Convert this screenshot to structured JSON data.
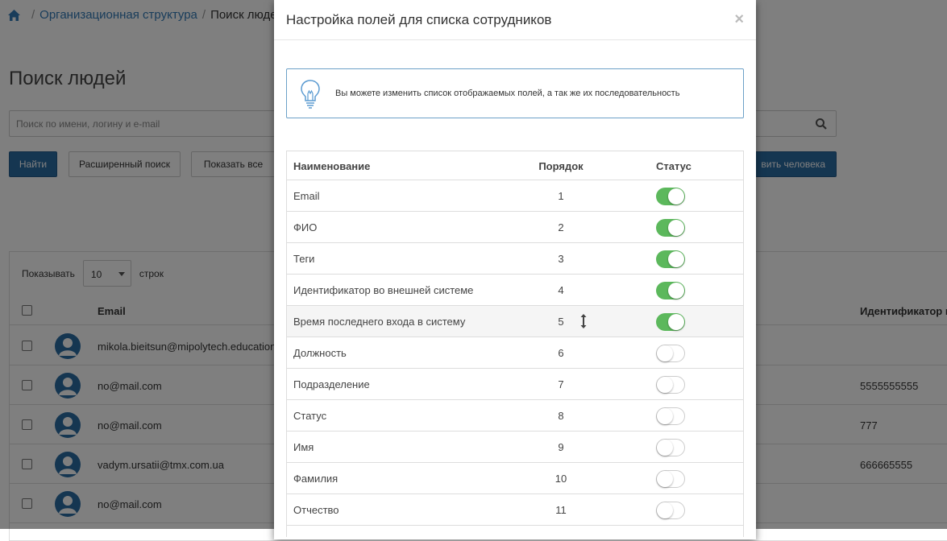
{
  "breadcrumb": {
    "home_icon": "home-icon",
    "org_link": "Организационная структура",
    "current": "Поиск людей"
  },
  "page": {
    "title": "Поиск людей",
    "search_placeholder": "Поиск по имени, логину и e-mail",
    "search_icon": "search-icon"
  },
  "toolbar": {
    "find": "Найти",
    "advanced": "Расширенный поиск",
    "show_all": "Показать все",
    "add_person": "вить человека"
  },
  "list": {
    "show_label": "Показывать",
    "rows_value": "10",
    "rows_label": "строк",
    "col_email": "Email",
    "col_ext_id": "Идентификатор в",
    "rows": [
      {
        "email": "mikola.bieitsun@mipolytech.education",
        "ext_id": ""
      },
      {
        "email": "no@mail.com",
        "ext_id": "5555555555"
      },
      {
        "email": "no@mail.com",
        "ext_id": "777"
      },
      {
        "email": "vadym.ursatii@tmx.com.ua",
        "ext_id": "666665555"
      },
      {
        "email": "no@mail.com",
        "ext_id": ""
      }
    ]
  },
  "modal": {
    "title": "Настройка полей для списка сотрудников",
    "close": "×",
    "info": "Вы можете изменить список отображаемых полей, а так же их последовательность",
    "col_name": "Наименование",
    "col_order": "Порядок",
    "col_status": "Статус",
    "fields": [
      {
        "name": "Email",
        "order": "1",
        "enabled": true
      },
      {
        "name": "ФИО",
        "order": "2",
        "enabled": true
      },
      {
        "name": "Теги",
        "order": "3",
        "enabled": true
      },
      {
        "name": "Идентификатор во внешней системе",
        "order": "4",
        "enabled": true
      },
      {
        "name": "Время последнего входа в систему",
        "order": "5",
        "enabled": true
      },
      {
        "name": "Должность",
        "order": "6",
        "enabled": false
      },
      {
        "name": "Подразделение",
        "order": "7",
        "enabled": false
      },
      {
        "name": "Статус",
        "order": "8",
        "enabled": false
      },
      {
        "name": "Имя",
        "order": "9",
        "enabled": false
      },
      {
        "name": "Фамилия",
        "order": "10",
        "enabled": false
      },
      {
        "name": "Отчество",
        "order": "11",
        "enabled": false
      }
    ]
  },
  "colors": {
    "primary": "#2b6ca3",
    "toggle_on": "#5cb85c",
    "link": "#337ab7"
  }
}
